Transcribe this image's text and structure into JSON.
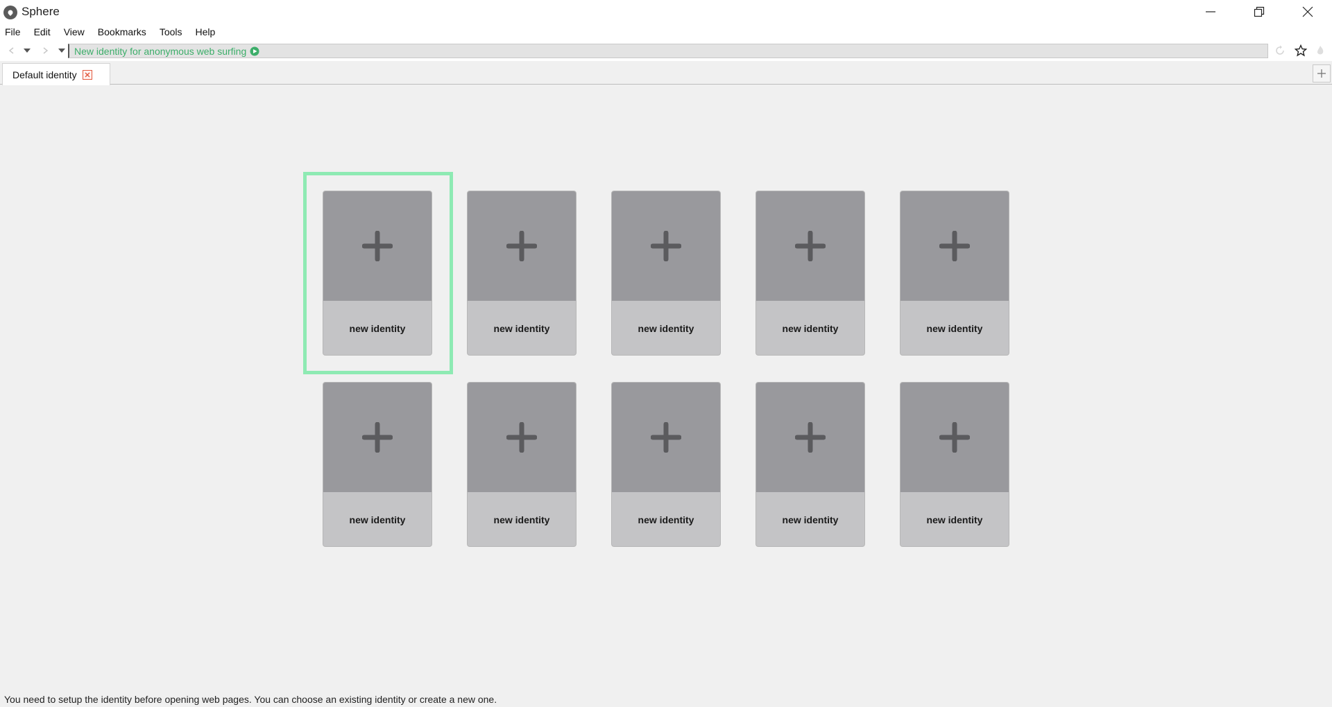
{
  "window": {
    "title": "Sphere"
  },
  "menu": [
    "File",
    "Edit",
    "View",
    "Bookmarks",
    "Tools",
    "Help"
  ],
  "address_bar": {
    "text": "New identity for anonymous web surfing"
  },
  "tabs": [
    {
      "label": "Default identity"
    }
  ],
  "identity_grid": {
    "selected_index": 0,
    "cards": [
      {
        "label": "new identity"
      },
      {
        "label": "new identity"
      },
      {
        "label": "new identity"
      },
      {
        "label": "new identity"
      },
      {
        "label": "new identity"
      },
      {
        "label": "new identity"
      },
      {
        "label": "new identity"
      },
      {
        "label": "new identity"
      },
      {
        "label": "new identity"
      },
      {
        "label": "new identity"
      }
    ]
  },
  "status": {
    "message": "You need to setup the identity before opening web pages. You can choose an existing identity or create a new one."
  },
  "colors": {
    "accent": "#3dae6a",
    "selection": "#8eeab3",
    "card_top": "#99999d",
    "card_bottom": "#c4c4c6"
  }
}
